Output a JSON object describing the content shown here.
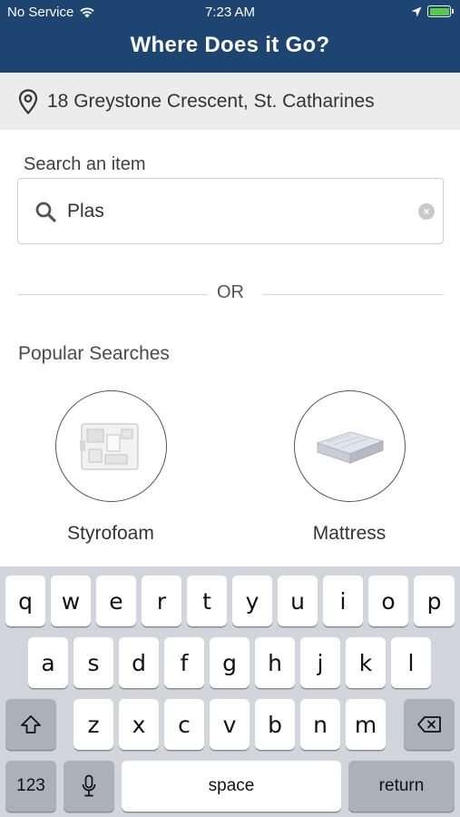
{
  "status_bar": {
    "carrier": "No Service",
    "time": "7:23 AM"
  },
  "header": {
    "title": "Where Does it Go?"
  },
  "address": {
    "icon": "location-pin-icon",
    "text": "18 Greystone Crescent, St. Catharines"
  },
  "search": {
    "label": "Search an item",
    "value": "Plas",
    "clear_icon": "clear-icon"
  },
  "divider": {
    "text": "OR"
  },
  "popular": {
    "title": "Popular Searches",
    "items": [
      {
        "label": "Styrofoam",
        "icon": "styrofoam-image"
      },
      {
        "label": "Mattress",
        "icon": "mattress-image"
      }
    ]
  },
  "keyboard": {
    "row1": [
      "q",
      "w",
      "e",
      "r",
      "t",
      "y",
      "u",
      "i",
      "o",
      "p"
    ],
    "row2": [
      "a",
      "s",
      "d",
      "f",
      "g",
      "h",
      "j",
      "k",
      "l"
    ],
    "row3": [
      "z",
      "x",
      "c",
      "v",
      "b",
      "n",
      "m"
    ],
    "numbers_label": "123",
    "space_label": "space",
    "return_label": "return"
  },
  "colors": {
    "header_bg": "#1e4472",
    "address_bg": "#ececec",
    "keyboard_bg": "#d2d5db"
  }
}
